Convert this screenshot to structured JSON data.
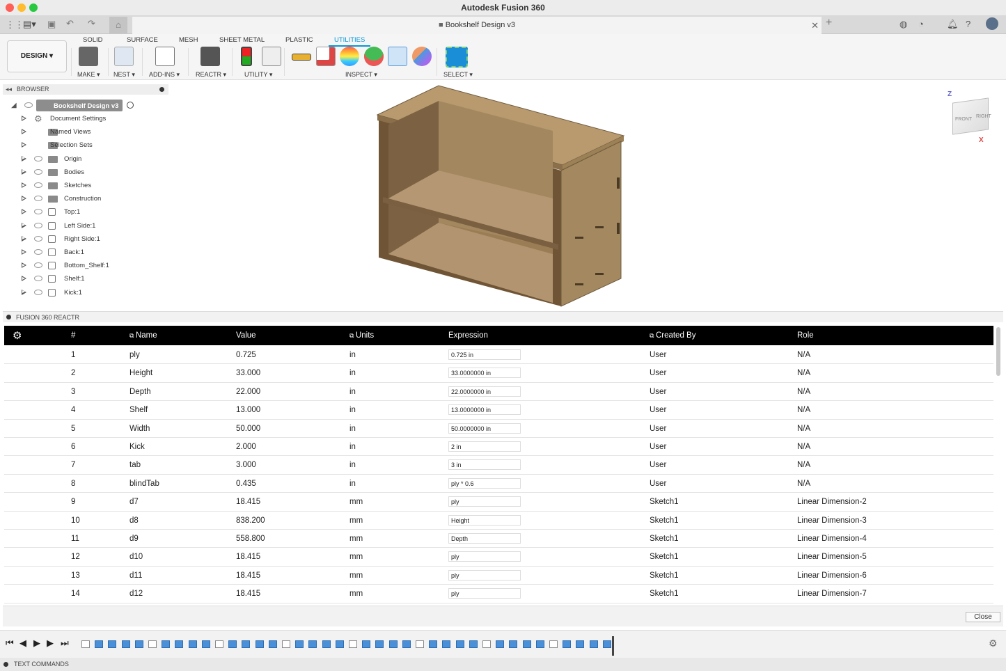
{
  "app_title": "Autodesk Fusion 360",
  "doc_tab": "Bookshelf Design v3",
  "workspace": "DESIGN ▾",
  "ribbon_tabs": [
    "SOLID",
    "SURFACE",
    "MESH",
    "SHEET METAL",
    "PLASTIC",
    "UTILITIES"
  ],
  "ribbon_groups": [
    "MAKE ▾",
    "NEST ▾",
    "ADD-INS ▾",
    "REACTR ▾",
    "UTILITY ▾",
    "INSPECT ▾",
    "SELECT ▾"
  ],
  "browser": {
    "title": "BROWSER",
    "root": "Bookshelf Design v3",
    "items": [
      {
        "label": "Document Settings",
        "icon": "gear-icon",
        "eye": false
      },
      {
        "label": "Named Views",
        "icon": "folder-icon",
        "eye": false
      },
      {
        "label": "Selection Sets",
        "icon": "folder-icon",
        "eye": false
      },
      {
        "label": "Origin",
        "icon": "folder-icon",
        "eye": true
      },
      {
        "label": "Bodies",
        "icon": "folder-icon",
        "eye": true
      },
      {
        "label": "Sketches",
        "icon": "folder-icon",
        "eye": true
      },
      {
        "label": "Construction",
        "icon": "folder-icon",
        "eye": true
      },
      {
        "label": "Top:1",
        "icon": "component-icon",
        "eye": true
      },
      {
        "label": "Left Side:1",
        "icon": "component-icon",
        "eye": true
      },
      {
        "label": "Right Side:1",
        "icon": "component-icon",
        "eye": true
      },
      {
        "label": "Back:1",
        "icon": "component-icon",
        "eye": true
      },
      {
        "label": "Bottom_Shelf:1",
        "icon": "component-icon",
        "eye": true
      },
      {
        "label": "Shelf:1",
        "icon": "component-icon",
        "eye": true
      },
      {
        "label": "Kick:1",
        "icon": "component-icon",
        "eye": true
      }
    ]
  },
  "viewcube": {
    "front": "FRONT",
    "right": "RIGHT",
    "z": "Z",
    "x": "X"
  },
  "reactr": {
    "title": "FUSION 360 REACTR",
    "columns": [
      "#",
      "Name",
      "Value",
      "Units",
      "Expression",
      "Created By",
      "Role"
    ],
    "rows": [
      [
        "1",
        "ply",
        "0.725",
        "in",
        "0.725 in",
        "User",
        "N/A"
      ],
      [
        "2",
        "Height",
        "33.000",
        "in",
        "33.0000000 in",
        "User",
        "N/A"
      ],
      [
        "3",
        "Depth",
        "22.000",
        "in",
        "22.0000000 in",
        "User",
        "N/A"
      ],
      [
        "4",
        "Shelf",
        "13.000",
        "in",
        "13.0000000 in",
        "User",
        "N/A"
      ],
      [
        "5",
        "Width",
        "50.000",
        "in",
        "50.0000000 in",
        "User",
        "N/A"
      ],
      [
        "6",
        "Kick",
        "2.000",
        "in",
        "2 in",
        "User",
        "N/A"
      ],
      [
        "7",
        "tab",
        "3.000",
        "in",
        "3 in",
        "User",
        "N/A"
      ],
      [
        "8",
        "blindTab",
        "0.435",
        "in",
        "ply * 0.6",
        "User",
        "N/A"
      ],
      [
        "9",
        "d7",
        "18.415",
        "mm",
        "ply",
        "Sketch1",
        "Linear Dimension-2"
      ],
      [
        "10",
        "d8",
        "838.200",
        "mm",
        "Height",
        "Sketch1",
        "Linear Dimension-3"
      ],
      [
        "11",
        "d9",
        "558.800",
        "mm",
        "Depth",
        "Sketch1",
        "Linear Dimension-4"
      ],
      [
        "12",
        "d10",
        "18.415",
        "mm",
        "ply",
        "Sketch1",
        "Linear Dimension-5"
      ],
      [
        "13",
        "d11",
        "18.415",
        "mm",
        "ply",
        "Sketch1",
        "Linear Dimension-6"
      ],
      [
        "14",
        "d12",
        "18.415",
        "mm",
        "ply",
        "Sketch1",
        "Linear Dimension-7"
      ]
    ],
    "close_label": "Close"
  },
  "text_commands": "TEXT COMMANDS",
  "colors": {
    "accent": "#0696d7",
    "wood": "#a88a62"
  }
}
